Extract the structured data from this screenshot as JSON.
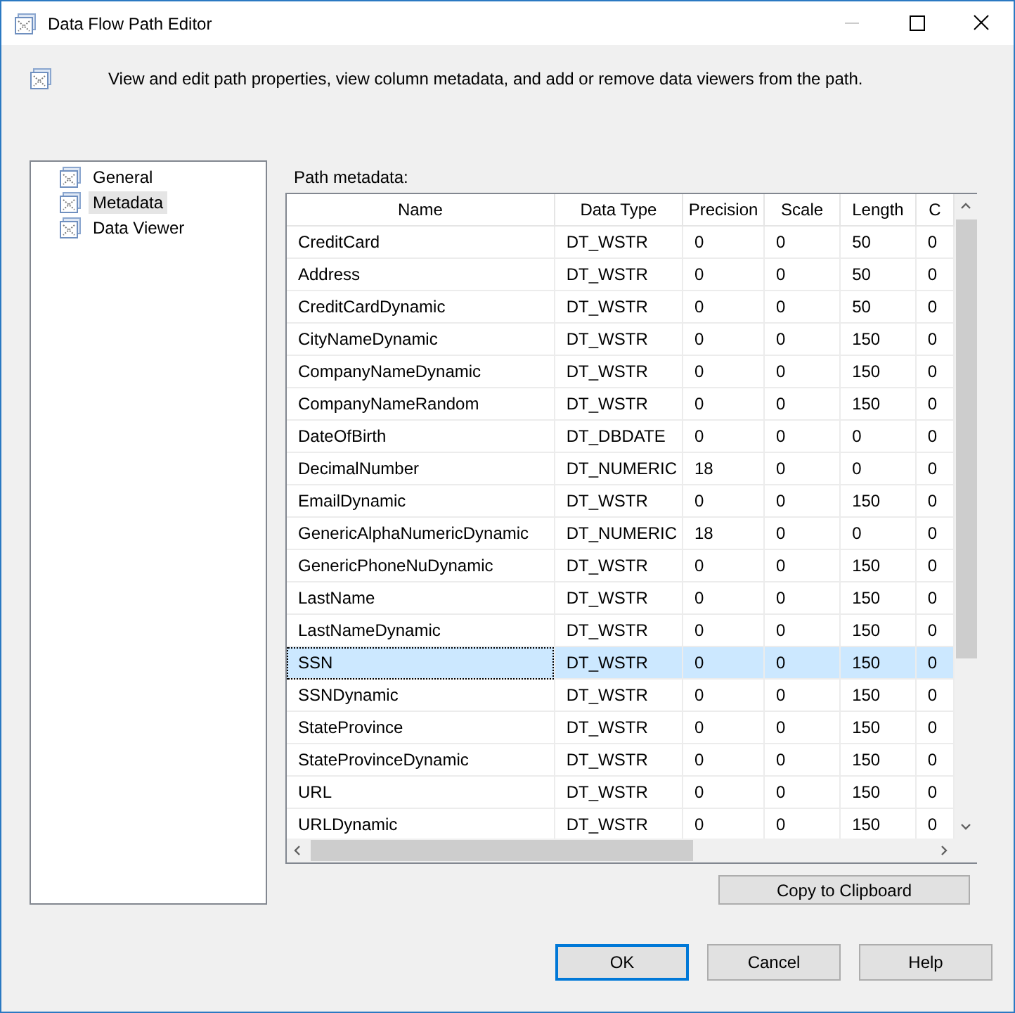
{
  "window": {
    "title": "Data Flow Path Editor",
    "description": "View and edit path properties, view column metadata, and add or remove data viewers from the path."
  },
  "sidebar": {
    "items": [
      {
        "label": "General",
        "selected": false
      },
      {
        "label": "Metadata",
        "selected": true
      },
      {
        "label": "Data Viewer",
        "selected": false
      }
    ]
  },
  "metadata_label": "Path metadata:",
  "table": {
    "columns": [
      "Name",
      "Data Type",
      "Precision",
      "Scale",
      "Length",
      "C"
    ],
    "rows": [
      {
        "cells": [
          "CreditCard",
          "DT_WSTR",
          "0",
          "0",
          "50",
          "0"
        ],
        "selected": false
      },
      {
        "cells": [
          "Address",
          "DT_WSTR",
          "0",
          "0",
          "50",
          "0"
        ],
        "selected": false
      },
      {
        "cells": [
          "CreditCardDynamic",
          "DT_WSTR",
          "0",
          "0",
          "50",
          "0"
        ],
        "selected": false
      },
      {
        "cells": [
          "CityNameDynamic",
          "DT_WSTR",
          "0",
          "0",
          "150",
          "0"
        ],
        "selected": false
      },
      {
        "cells": [
          "CompanyNameDynamic",
          "DT_WSTR",
          "0",
          "0",
          "150",
          "0"
        ],
        "selected": false
      },
      {
        "cells": [
          "CompanyNameRandom",
          "DT_WSTR",
          "0",
          "0",
          "150",
          "0"
        ],
        "selected": false
      },
      {
        "cells": [
          "DateOfBirth",
          "DT_DBDATE",
          "0",
          "0",
          "0",
          "0"
        ],
        "selected": false
      },
      {
        "cells": [
          "DecimalNumber",
          "DT_NUMERIC",
          "18",
          "0",
          "0",
          "0"
        ],
        "selected": false
      },
      {
        "cells": [
          "EmailDynamic",
          "DT_WSTR",
          "0",
          "0",
          "150",
          "0"
        ],
        "selected": false
      },
      {
        "cells": [
          "GenericAlphaNumericDynamic",
          "DT_NUMERIC",
          "18",
          "0",
          "0",
          "0"
        ],
        "selected": false
      },
      {
        "cells": [
          "GenericPhoneNuDynamic",
          "DT_WSTR",
          "0",
          "0",
          "150",
          "0"
        ],
        "selected": false
      },
      {
        "cells": [
          "LastName",
          "DT_WSTR",
          "0",
          "0",
          "150",
          "0"
        ],
        "selected": false
      },
      {
        "cells": [
          "LastNameDynamic",
          "DT_WSTR",
          "0",
          "0",
          "150",
          "0"
        ],
        "selected": false
      },
      {
        "cells": [
          "SSN",
          "DT_WSTR",
          "0",
          "0",
          "150",
          "0"
        ],
        "selected": true
      },
      {
        "cells": [
          "SSNDynamic",
          "DT_WSTR",
          "0",
          "0",
          "150",
          "0"
        ],
        "selected": false
      },
      {
        "cells": [
          "StateProvince",
          "DT_WSTR",
          "0",
          "0",
          "150",
          "0"
        ],
        "selected": false
      },
      {
        "cells": [
          "StateProvinceDynamic",
          "DT_WSTR",
          "0",
          "0",
          "150",
          "0"
        ],
        "selected": false
      },
      {
        "cells": [
          "URL",
          "DT_WSTR",
          "0",
          "0",
          "150",
          "0"
        ],
        "selected": false
      },
      {
        "cells": [
          "URLDynamic",
          "DT_WSTR",
          "0",
          "0",
          "150",
          "0"
        ],
        "selected": false
      }
    ]
  },
  "copy_button": "Copy to Clipboard",
  "buttons": [
    {
      "label": "OK",
      "default": true
    },
    {
      "label": "Cancel",
      "default": false
    },
    {
      "label": "Help",
      "default": false
    }
  ]
}
